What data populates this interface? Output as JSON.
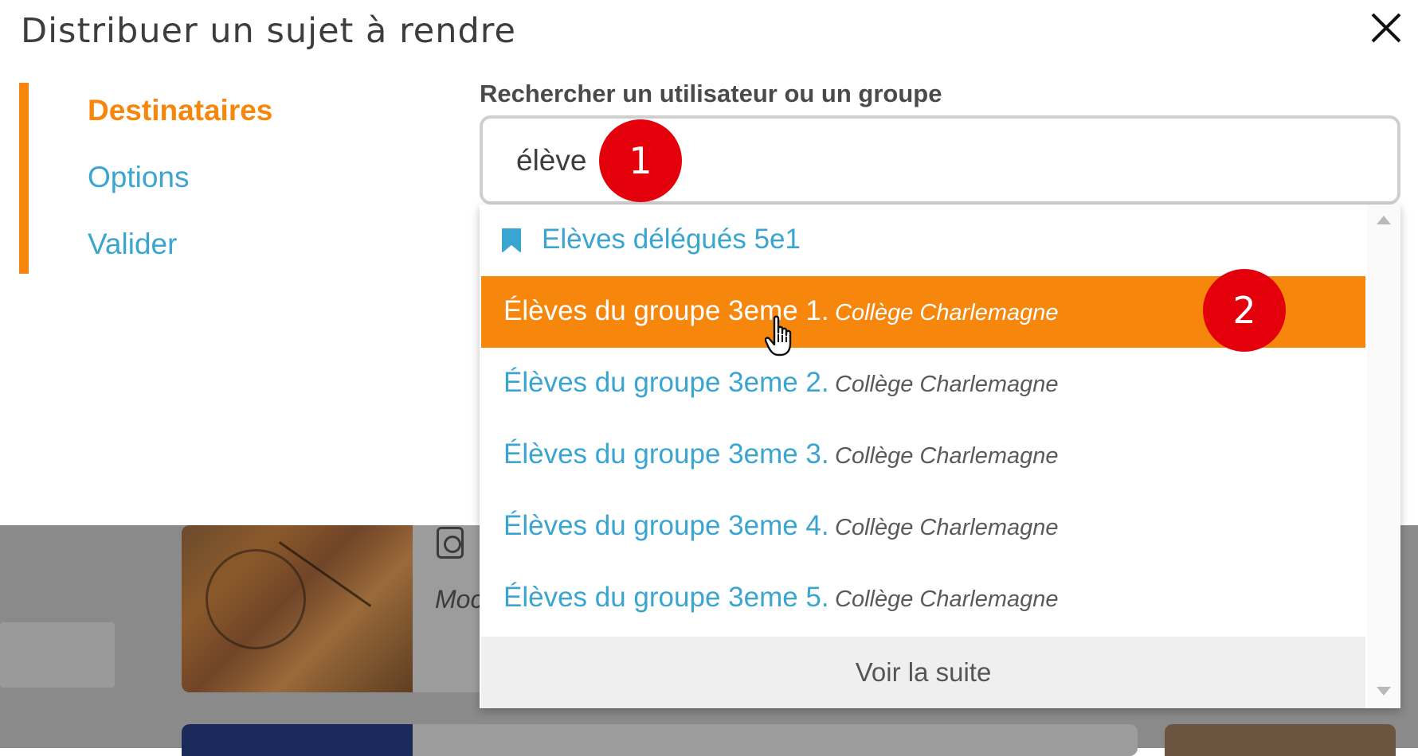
{
  "modal": {
    "title": "Distribuer un sujet à rendre"
  },
  "steps": [
    {
      "label": "Destinataires",
      "active": true
    },
    {
      "label": "Options",
      "active": false
    },
    {
      "label": "Valider",
      "active": false
    }
  ],
  "search": {
    "label": "Rechercher un utilisateur ou un groupe",
    "value": "élève"
  },
  "dropdown": {
    "items": [
      {
        "name": "Elèves délégués 5e1",
        "school": "",
        "icon": "bookmark-icon",
        "highlighted": false
      },
      {
        "name": "Élèves du groupe 3eme 1.",
        "school": "Collège Charlemagne",
        "highlighted": true
      },
      {
        "name": "Élèves du groupe 3eme 2.",
        "school": "Collège Charlemagne",
        "highlighted": false
      },
      {
        "name": "Élèves du groupe 3eme 3.",
        "school": "Collège Charlemagne",
        "highlighted": false
      },
      {
        "name": "Élèves du groupe 3eme 4.",
        "school": "Collège Charlemagne",
        "highlighted": false
      },
      {
        "name": "Élèves du groupe 3eme 5.",
        "school": "Collège Charlemagne",
        "highlighted": false
      }
    ],
    "see_more": "Voir la suite"
  },
  "annotations": {
    "badge1": "1",
    "badge2": "2"
  },
  "background": {
    "partial_text": "Moc"
  },
  "colors": {
    "accent_orange": "#f7860d",
    "link_blue": "#3aa5d0",
    "badge_red": "#e3000b"
  }
}
